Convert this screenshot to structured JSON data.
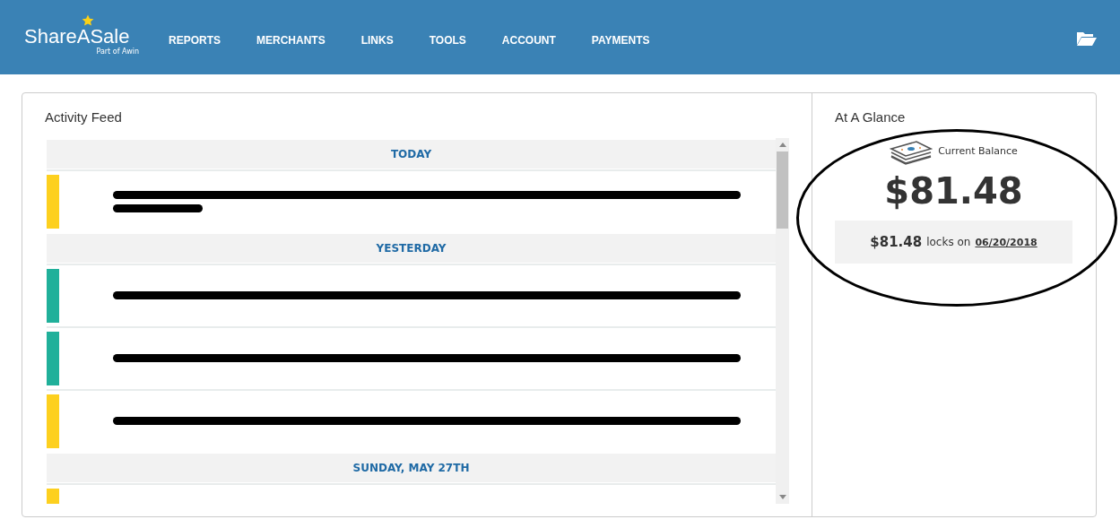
{
  "header": {
    "logo": {
      "name": "ShareASale",
      "tagline": "Part of Awin"
    },
    "nav": [
      {
        "label": "REPORTS"
      },
      {
        "label": "MERCHANTS"
      },
      {
        "label": "LINKS"
      },
      {
        "label": "TOOLS"
      },
      {
        "label": "ACCOUNT"
      },
      {
        "label": "PAYMENTS"
      }
    ]
  },
  "activity_feed": {
    "title": "Activity Feed",
    "entries": [
      {
        "kind": "date",
        "label": "TODAY"
      },
      {
        "kind": "item",
        "color": "#fdd01f",
        "redacted": true,
        "wraps": true
      },
      {
        "kind": "date",
        "label": "YESTERDAY"
      },
      {
        "kind": "item",
        "color": "#20b09a",
        "redacted": true,
        "wraps": false
      },
      {
        "kind": "item",
        "color": "#20b09a",
        "redacted": true,
        "wraps": false
      },
      {
        "kind": "item",
        "color": "#fdd01f",
        "redacted": true,
        "wraps": false
      },
      {
        "kind": "date",
        "label": "SUNDAY, MAY 27TH"
      },
      {
        "kind": "item",
        "color": "#fdd01f"
      }
    ]
  },
  "at_a_glance": {
    "title": "At A Glance",
    "balance_label": "Current Balance",
    "balance": "$81.48",
    "lock_amount": "$81.48",
    "lock_text": "locks on",
    "lock_date": "06/20/2018"
  },
  "annotation": {
    "kind": "ellipse"
  }
}
